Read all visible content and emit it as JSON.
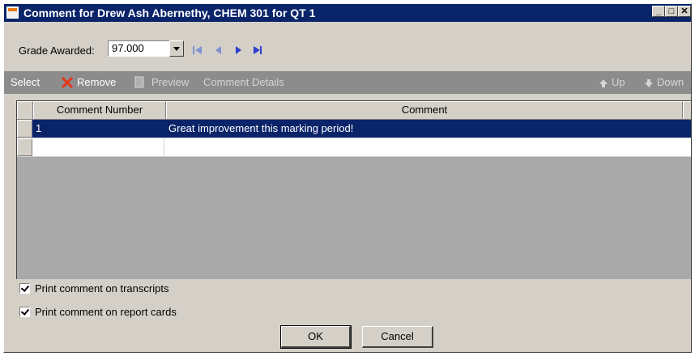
{
  "window": {
    "title": "Comment for Drew Ash Abernethy, CHEM 301 for QT 1"
  },
  "grade": {
    "label": "Grade Awarded:",
    "value": "97.000"
  },
  "toolbar": {
    "select_label": "Select",
    "remove_label": "Remove",
    "preview_label": "Preview",
    "details_label": "Comment Details",
    "up_label": "Up",
    "down_label": "Down"
  },
  "grid": {
    "columns": [
      "Comment Number",
      "Comment"
    ],
    "rows": [
      {
        "number": "1",
        "comment": "Great improvement this marking period!",
        "selected": true
      },
      {
        "number": "",
        "comment": "",
        "selected": false
      }
    ]
  },
  "options": {
    "transcripts_label": "Print comment on transcripts",
    "transcripts_checked": true,
    "reportcards_label": "Print comment on report cards",
    "reportcards_checked": true
  },
  "buttons": {
    "ok_label": "OK",
    "cancel_label": "Cancel"
  },
  "colors": {
    "titlebar": "#0a246a",
    "toolbar": "#8c8c8c",
    "selection": "#0a246a",
    "nav_arrows": "#3b4fd1",
    "remove_icon": "#e8361a"
  }
}
